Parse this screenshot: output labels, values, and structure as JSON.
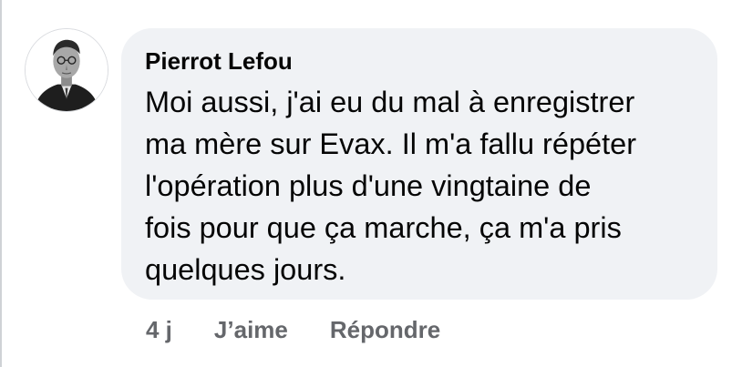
{
  "comment": {
    "author": "Pierrot Lefou",
    "text": "Moi aussi, j'ai eu du mal à enregistrer\nma mère sur Evax. Il m'a fallu répéter\nl'opération plus d'une vingtaine de\nfois pour que ça marche, ça m'a pris\nquelques jours.",
    "avatar_icon": "profile-photo-icon"
  },
  "actions": {
    "timestamp": "4 j",
    "like_label": "J’aime",
    "reply_label": "Répondre"
  },
  "colors": {
    "bubble": "#f0f2f5",
    "text": "#050505",
    "secondary_text": "#65676b"
  }
}
